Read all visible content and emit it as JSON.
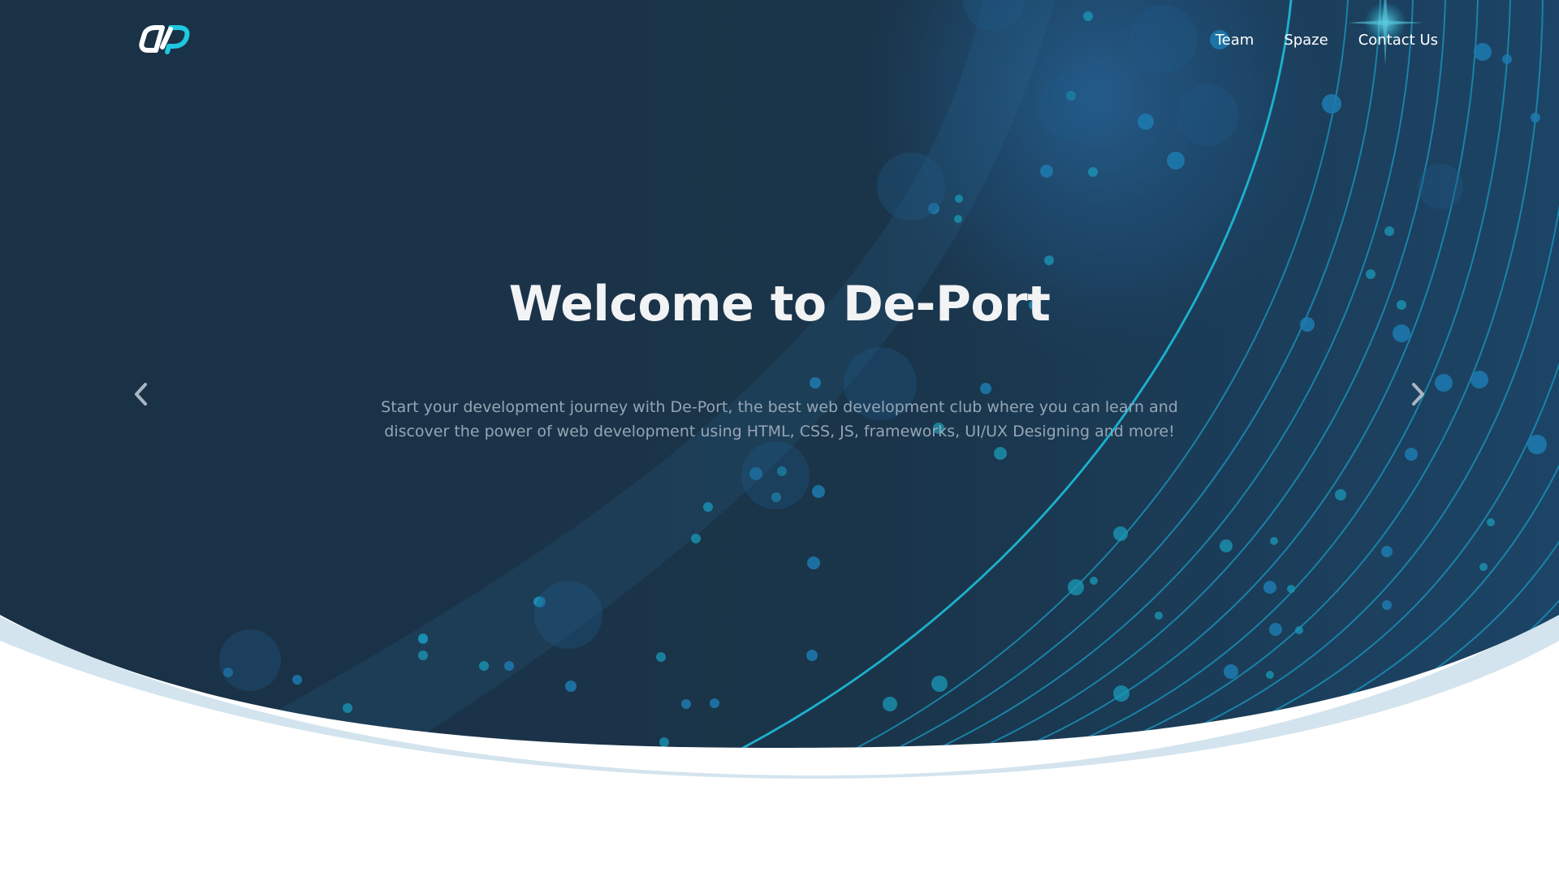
{
  "header": {
    "logo_icon": "de-port-logo",
    "nav": [
      {
        "label": "Team"
      },
      {
        "label": "Spaze"
      },
      {
        "label": "Contact Us"
      }
    ]
  },
  "hero": {
    "title": "Welcome to De-Port",
    "description": "Start your development journey with De-Port, the best web development club where you can learn and discover the power of web development using HTML, CSS, JS, frameworks, UI/UX Designing and more!",
    "prev_icon": "chevron-left-icon",
    "next_icon": "chevron-right-icon"
  },
  "colors": {
    "hero_background": "#1a3145",
    "accent_cyan": "#1ec8e0",
    "wave_light": "#d3e4ee",
    "text_primary": "#f2f3f5",
    "text_secondary": "#95a6b5"
  }
}
